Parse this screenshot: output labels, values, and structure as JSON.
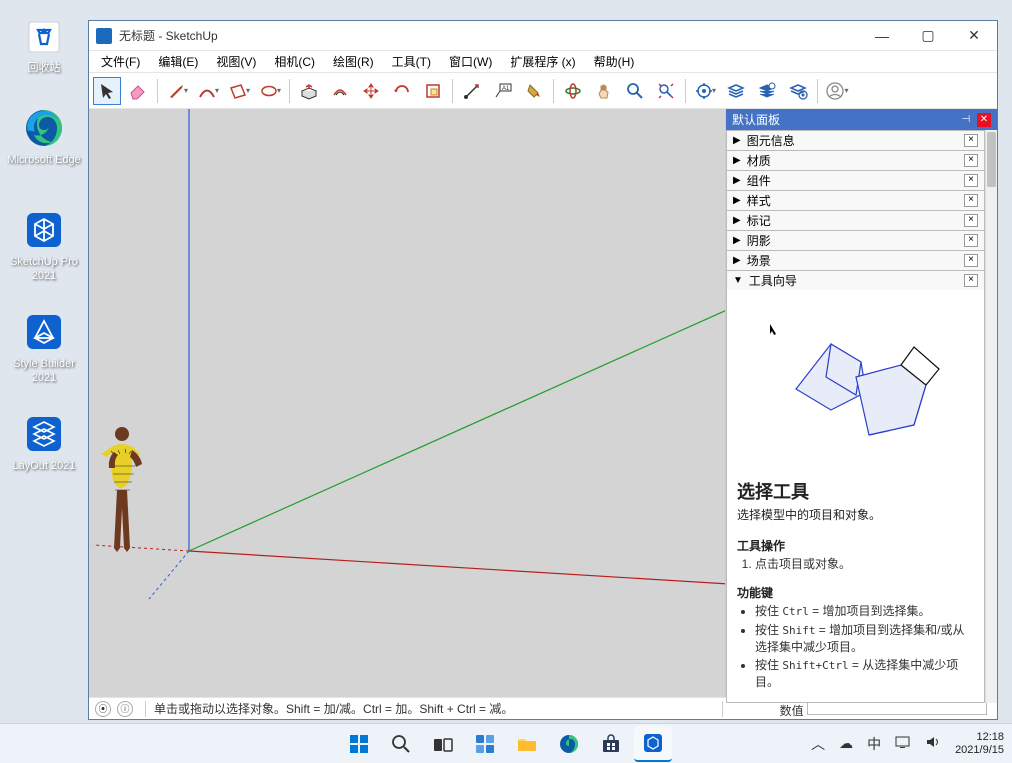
{
  "desktop": {
    "icons": [
      {
        "name": "recycle-bin",
        "label": "回收站"
      },
      {
        "name": "edge",
        "label": "Microsoft Edge"
      },
      {
        "name": "sketchup-pro",
        "label": "SketchUp Pro 2021"
      },
      {
        "name": "style-builder",
        "label": "Style Builder 2021"
      },
      {
        "name": "layout",
        "label": "LayOut 2021"
      }
    ]
  },
  "app": {
    "title": "无标题 - SketchUp",
    "menus": [
      "文件(F)",
      "编辑(E)",
      "视图(V)",
      "相机(C)",
      "绘图(R)",
      "工具(T)",
      "窗口(W)",
      "扩展程序 (x)",
      "帮助(H)"
    ]
  },
  "panel": {
    "title": "默认面板",
    "sections": [
      "图元信息",
      "材质",
      "组件",
      "样式",
      "标记",
      "阴影",
      "场景",
      "工具向导"
    ]
  },
  "guide": {
    "title": "选择工具",
    "subtitle": "选择模型中的项目和对象。",
    "ops_h": "工具操作",
    "ops": [
      "点击项目或对象。"
    ],
    "keys_h": "功能键",
    "keys": [
      {
        "label": "Ctrl",
        "text": "按住 ",
        "suffix": " = 增加项目到选择集。"
      },
      {
        "label": "Shift",
        "text": "按住 ",
        "suffix": " = 增加项目到选择集和/或从选择集中减少项目。"
      },
      {
        "label": "Shift+Ctrl",
        "text": "按住 ",
        "suffix": " = 从选择集中减少项目。"
      }
    ]
  },
  "status": {
    "hint": "单击或拖动以选择对象。Shift = 加/减。Ctrl = 加。Shift + Ctrl = 减。",
    "vcb_label": "数值"
  },
  "taskbar": {
    "ime": "中",
    "time": "12:18",
    "date": "2021/9/15"
  }
}
